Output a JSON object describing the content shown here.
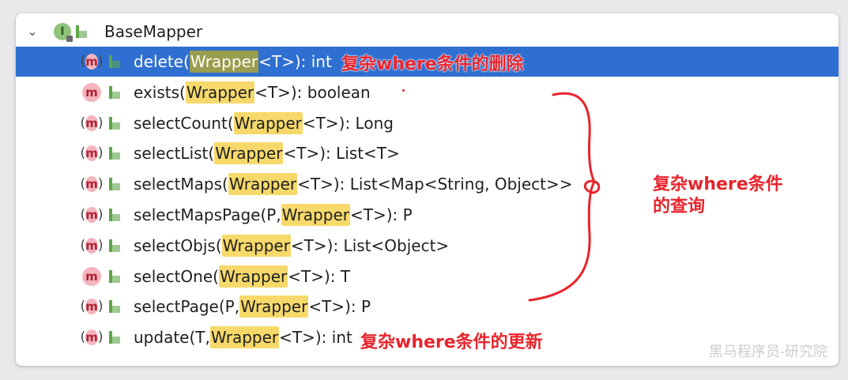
{
  "tree": {
    "root": {
      "label": "BaseMapper",
      "icon": "interface-icon",
      "icon_letter": "I",
      "expanded": true
    },
    "methods": [
      {
        "name": "delete",
        "open": "(",
        "pre": "",
        "type": "Wrapper",
        "post": "<T>): int",
        "selected": true,
        "abstract": true
      },
      {
        "name": "exists",
        "open": "(",
        "pre": "",
        "type": "Wrapper",
        "post": "<T>): boolean",
        "selected": false,
        "abstract": false
      },
      {
        "name": "selectCount",
        "open": "(",
        "pre": "",
        "type": "Wrapper",
        "post": "<T>): Long",
        "selected": false,
        "abstract": true
      },
      {
        "name": "selectList",
        "open": "(",
        "pre": "",
        "type": "Wrapper",
        "post": "<T>): List<T>",
        "selected": false,
        "abstract": true
      },
      {
        "name": "selectMaps",
        "open": "(",
        "pre": "",
        "type": "Wrapper",
        "post": "<T>): List<Map<String, Object>>",
        "selected": false,
        "abstract": true
      },
      {
        "name": "selectMapsPage",
        "open": "(",
        "pre": "P, ",
        "type": "Wrapper",
        "post": "<T>): P",
        "selected": false,
        "abstract": true
      },
      {
        "name": "selectObjs",
        "open": "(",
        "pre": "",
        "type": "Wrapper",
        "post": "<T>): List<Object>",
        "selected": false,
        "abstract": true
      },
      {
        "name": "selectOne",
        "open": "(",
        "pre": "",
        "type": "Wrapper",
        "post": "<T>): T",
        "selected": false,
        "abstract": false
      },
      {
        "name": "selectPage",
        "open": "(",
        "pre": "P, ",
        "type": "Wrapper",
        "post": "<T>): P",
        "selected": false,
        "abstract": true
      },
      {
        "name": "update",
        "open": "(",
        "pre": "T, ",
        "type": "Wrapper",
        "post": "<T>): int",
        "selected": false,
        "abstract": true
      }
    ],
    "method_icon_letter": "m"
  },
  "annotations": {
    "delete": "复杂where条件的删除",
    "query_line1": "复杂where条件",
    "query_line2": "的查询",
    "update": "复杂where条件的更新"
  },
  "watermark": "黑马程序员-研究院",
  "colors": {
    "selection": "#2f6fd1",
    "highlight": "#f6d96a",
    "annotation": "#e8242c"
  }
}
